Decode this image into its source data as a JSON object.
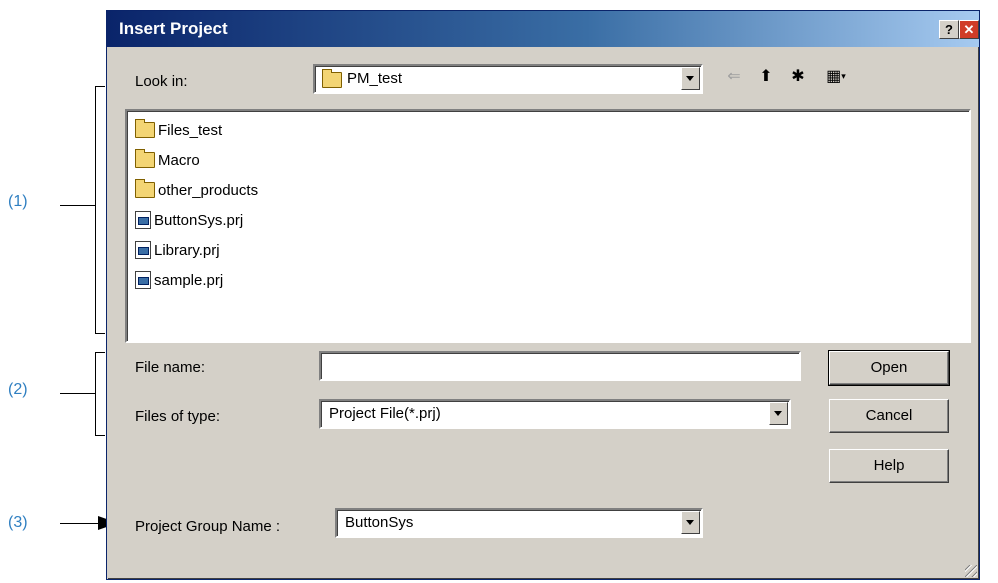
{
  "annotations": {
    "callout1": "(1)",
    "callout2": "(2)",
    "callout3": "(3)"
  },
  "dialog": {
    "title": "Insert Project",
    "help_glyph": "?",
    "close_glyph": "✕",
    "look_in_label": "Look in:",
    "look_in_value": "PM_test",
    "toolbar": {
      "back_glyph": "⇐",
      "up_folder_glyph": "⬆",
      "new_folder_glyph": "✱",
      "view_menu_glyph": "▦"
    },
    "files": [
      {
        "name": "Files_test",
        "icon": "folder-icon"
      },
      {
        "name": "Macro",
        "icon": "folder-icon"
      },
      {
        "name": "other_products",
        "icon": "folder-icon"
      },
      {
        "name": "ButtonSys.prj",
        "icon": "project-file-icon"
      },
      {
        "name": "Library.prj",
        "icon": "project-file-icon"
      },
      {
        "name": "sample.prj",
        "icon": "project-file-icon"
      }
    ],
    "file_name_label": "File name:",
    "file_name_value": "",
    "files_of_type_label": "Files of type:",
    "files_of_type_value": "Project File(*.prj)",
    "project_group_label": "Project Group Name :",
    "project_group_value": "ButtonSys",
    "buttons": {
      "open": "Open",
      "cancel": "Cancel",
      "help": "Help"
    }
  }
}
